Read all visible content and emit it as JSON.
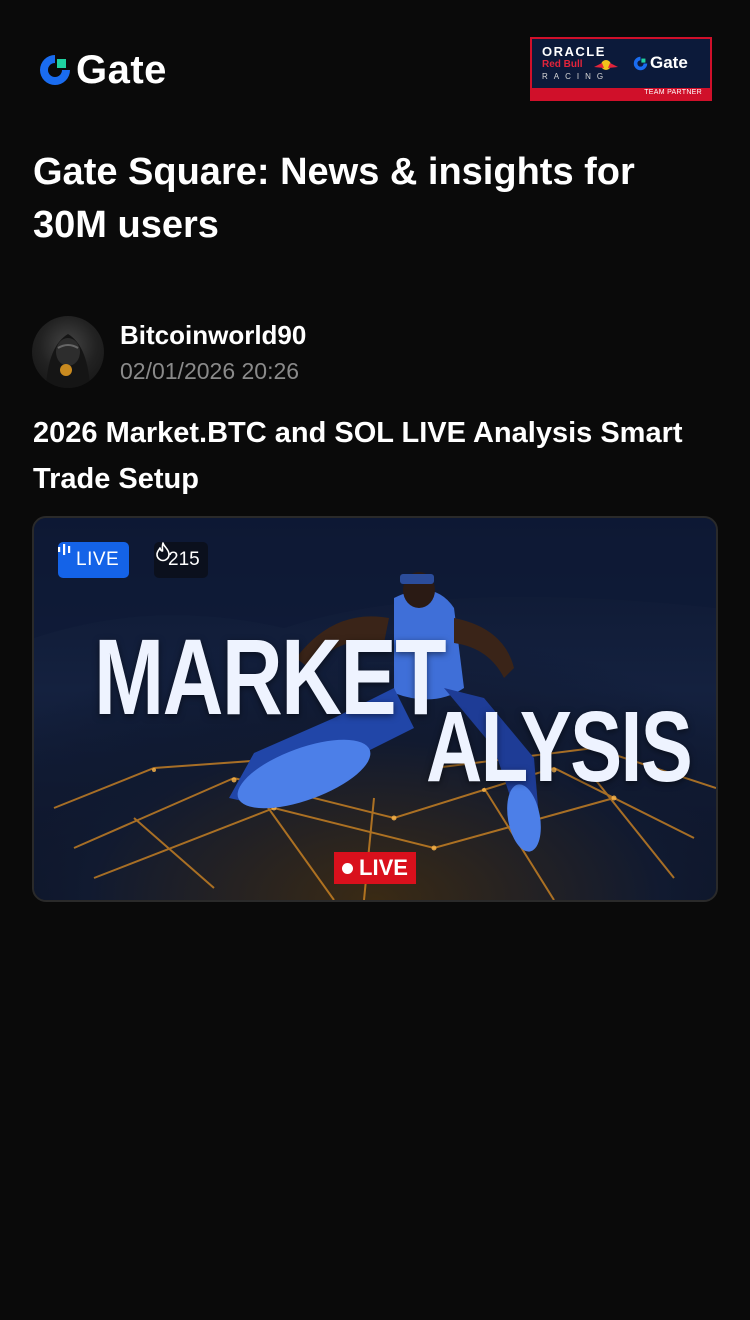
{
  "header": {
    "brand": "Gate",
    "partner": {
      "oracle": "ORACLE",
      "redbull": "Red Bull",
      "racing": "RACING",
      "gate": "Gate",
      "band": "TEAM PARTNER"
    }
  },
  "headline": "Gate Square: News & insights for 30M users",
  "post": {
    "author": "Bitcoinworld90",
    "timestamp": "02/01/2026 20:26",
    "title": "2026 Market.BTC and SOL LIVE Analysis Smart Trade Setup",
    "live_badge": "LIVE",
    "viewers": "215",
    "thumbnail": {
      "line1": "MARKET",
      "line2": "ALYSIS",
      "live_tag": "LIVE"
    }
  },
  "colors": {
    "background": "#0a0a0a",
    "brand_blue": "#1463e8",
    "live_red": "#d9101c",
    "secondary_text": "#8a8a8a"
  },
  "icons": [
    "gate-logo-icon",
    "live-bars-icon",
    "flame-icon",
    "red-bull-icon"
  ]
}
